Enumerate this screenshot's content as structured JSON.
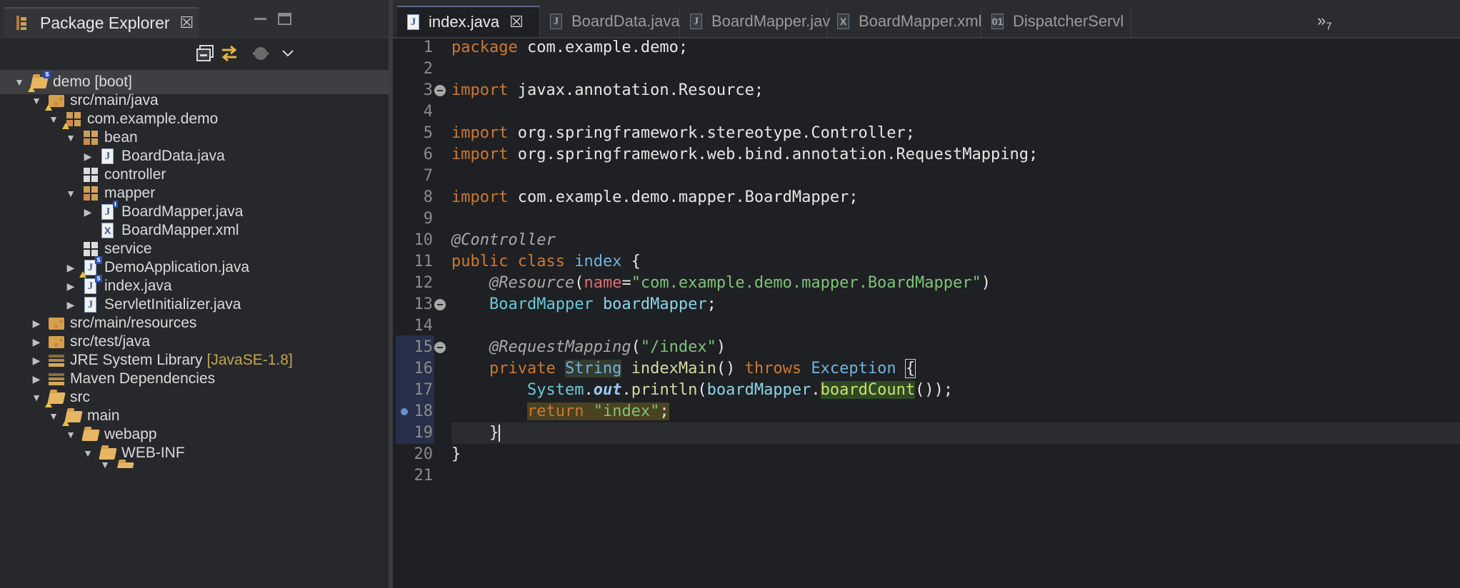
{
  "explorer": {
    "title": "Package Explorer",
    "close_glyph": "☒",
    "tree": [
      {
        "label": "demo [boot]",
        "icon": "maven-spring-project-icon",
        "expanded": true,
        "selected": true
      },
      {
        "label": "src/main/java",
        "icon": "source-folder-icon",
        "expanded": true
      },
      {
        "label": "com.example.demo",
        "icon": "package-icon",
        "expanded": true
      },
      {
        "label": "bean",
        "icon": "package-icon",
        "expanded": true
      },
      {
        "label": "BoardData.java",
        "icon": "java-file-icon",
        "expanded": false
      },
      {
        "label": "controller",
        "icon": "empty-package-icon"
      },
      {
        "label": "mapper",
        "icon": "package-icon",
        "expanded": true
      },
      {
        "label": "BoardMapper.java",
        "icon": "java-interface-icon",
        "expanded": false
      },
      {
        "label": "BoardMapper.xml",
        "icon": "xml-file-icon"
      },
      {
        "label": "service",
        "icon": "empty-package-icon"
      },
      {
        "label": "DemoApplication.java",
        "icon": "java-file-icon",
        "expanded": false
      },
      {
        "label": "index.java",
        "icon": "java-file-icon",
        "expanded": false
      },
      {
        "label": "ServletInitializer.java",
        "icon": "java-file-icon",
        "expanded": false
      },
      {
        "label": "src/main/resources",
        "icon": "source-folder-icon",
        "expanded": false
      },
      {
        "label": "src/test/java",
        "icon": "source-folder-icon",
        "expanded": false
      },
      {
        "label": "JRE System Library",
        "decoration": "[JavaSE-1.8]",
        "icon": "library-icon",
        "expanded": false
      },
      {
        "label": "Maven Dependencies",
        "icon": "library-icon",
        "expanded": false
      },
      {
        "label": "src",
        "icon": "folder-icon",
        "expanded": true
      },
      {
        "label": "main",
        "icon": "folder-icon",
        "expanded": true
      },
      {
        "label": "webapp",
        "icon": "folder-icon",
        "expanded": true
      },
      {
        "label": "WEB-INF",
        "icon": "folder-icon",
        "expanded": true
      }
    ]
  },
  "editor": {
    "tabs": [
      {
        "label": "index.java",
        "icon": "java-file-icon",
        "active": true
      },
      {
        "label": "BoardData.java",
        "icon": "java-file-icon",
        "active": false
      },
      {
        "label": "BoardMapper.jav",
        "icon": "java-file-icon",
        "active": false
      },
      {
        "label": "BoardMapper.xml",
        "icon": "xml-file-icon",
        "active": false
      },
      {
        "label": "DispatcherServl",
        "icon": "xml-file-icon",
        "active": false
      }
    ],
    "overflow": {
      "glyph": "»",
      "count": "7"
    },
    "lines": {
      "l1": [
        "package",
        " com.example.demo;"
      ],
      "l3": [
        "import",
        " javax.annotation.Resource;"
      ],
      "l5": [
        "import",
        " org.springframework.stereotype.Controller;"
      ],
      "l6": [
        "import",
        " org.springframework.web.bind.annotation.RequestMapping;"
      ],
      "l8": [
        "import",
        " com.example.demo.mapper.BoardMapper;"
      ],
      "l10": [
        "@Controller"
      ],
      "l11": [
        "public class",
        " ",
        "index",
        " {"
      ],
      "l12": [
        "    ",
        "@Resource",
        "(",
        "name",
        "=",
        "\"com.example.demo.mapper.BoardMapper\"",
        ")"
      ],
      "l13": [
        "    ",
        "BoardMapper",
        " ",
        "boardMapper",
        ";"
      ],
      "l15": [
        "    ",
        "@RequestMapping",
        "(",
        "\"/index\"",
        ")"
      ],
      "l16": [
        "    ",
        "private",
        " ",
        "String",
        " ",
        "indexMain",
        "() ",
        "throws",
        " ",
        "Exception",
        " ",
        "{"
      ],
      "l17": [
        "        ",
        "System",
        ".",
        "out",
        ".",
        "println",
        "(",
        "boardMapper",
        ".",
        "boardCount",
        "());"
      ],
      "l18": [
        "        ",
        "return",
        " ",
        "\"index\"",
        ";"
      ],
      "l19": [
        "    }"
      ],
      "l20": [
        "}"
      ]
    },
    "line_numbers": [
      "1",
      "2",
      "3",
      "4",
      "5",
      "6",
      "7",
      "8",
      "9",
      "10",
      "11",
      "12",
      "13",
      "14",
      "15",
      "16",
      "17",
      "18",
      "19",
      "20",
      "21"
    ]
  }
}
